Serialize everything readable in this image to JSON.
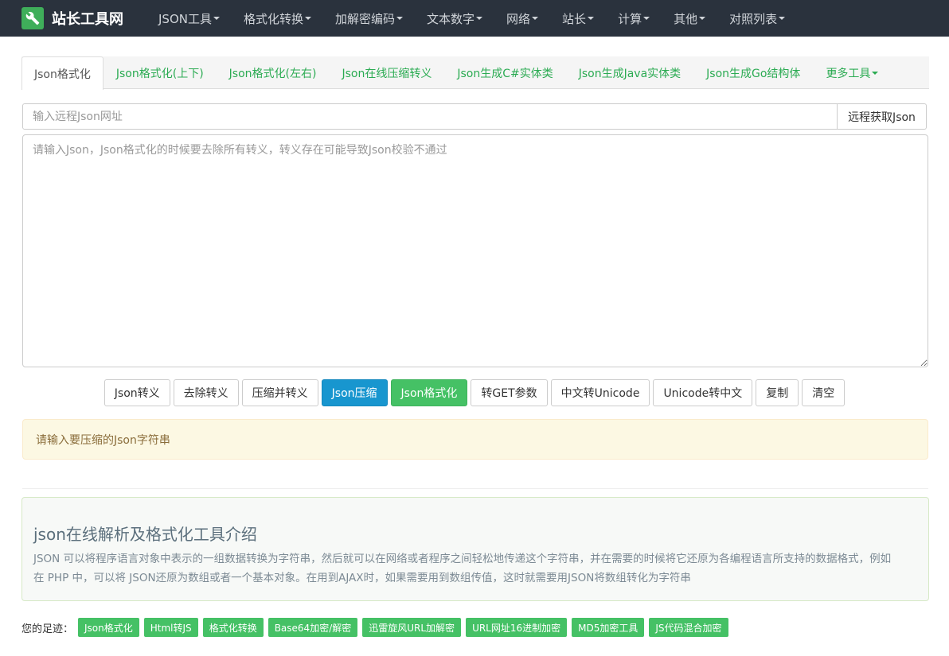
{
  "navbar": {
    "brand": "站长工具网",
    "items": [
      "JSON工具",
      "格式化转换",
      "加解密编码",
      "文本数字",
      "网络",
      "站长",
      "计算",
      "其他",
      "对照列表"
    ]
  },
  "tabs": [
    "Json格式化",
    "Json格式化(上下)",
    "Json格式化(左右)",
    "Json在线压缩转义",
    "Json生成C#实体类",
    "Json生成Java实体类",
    "Json生成Go结构体",
    "更多工具"
  ],
  "remote": {
    "placeholder": "输入远程Json网址",
    "button": "远程获取Json"
  },
  "editor": {
    "placeholder": "请输入Json，Json格式化的时候要去除所有转义，转义存在可能导致Json校验不通过"
  },
  "actions": [
    "Json转义",
    "去除转义",
    "压缩并转义",
    "Json压缩",
    "Json格式化",
    "转GET参数",
    "中文转Unicode",
    "Unicode转中文",
    "复制",
    "清空"
  ],
  "alert": "请输入要压缩的Json字符串",
  "intro": {
    "title": "json在线解析及格式化工具介绍",
    "text": "JSON 可以将程序语言对象中表示的一组数据转换为字符串，然后就可以在网络或者程序之间轻松地传递这个字符串，并在需要的时候将它还原为各编程语言所支持的数据格式，例如在 PHP 中，可以将 JSON还原为数组或者一个基本对象。在用到AJAX时，如果需要用到数组传值，这时就需要用JSON将数组转化为字符串"
  },
  "footprints": {
    "label": "您的足迹：",
    "items": [
      "Json格式化",
      "Html转JS",
      "格式化转换",
      "Base64加密/解密",
      "迅雷旋风URL加解密",
      "URL网址16进制加密",
      "MD5加密工具",
      "JS代码混合加密"
    ]
  },
  "colors": {
    "navbar": "#2a323d",
    "brand_green": "#3fae5a",
    "tab_link": "#2bab52",
    "btn_blue": "#1896cf",
    "btn_green": "#45c165"
  },
  "icons": {
    "brand": "wrench-icon"
  }
}
